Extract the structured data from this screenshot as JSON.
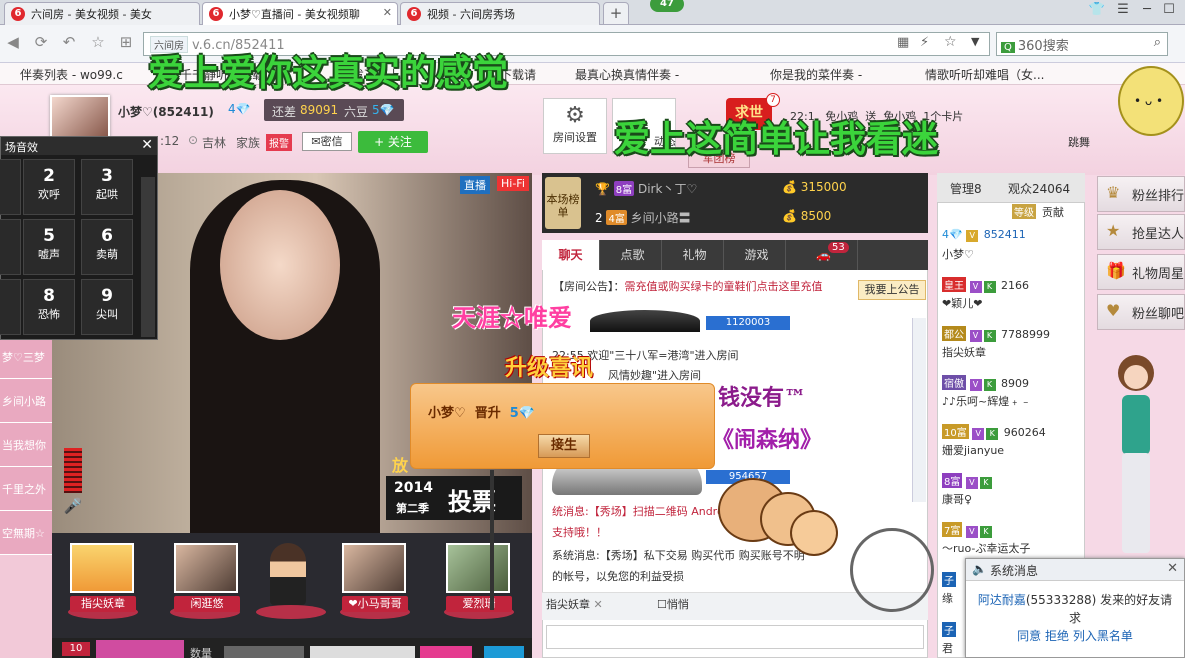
{
  "browser": {
    "tabs": [
      {
        "label": "六间房 - 美女视频 - 美女",
        "active": false
      },
      {
        "label": "小梦♡直播间 - 美女视频聊",
        "active": true
      },
      {
        "label": "视频 - 六间房秀场",
        "active": false
      }
    ],
    "notification_count": "47",
    "url_site_tag": "六间房",
    "url": "v.6.cn/852411",
    "search_placeholder": "360搜索",
    "bookmarks": [
      "伴奏列表 - wo99.c",
      "千千静听 - 下载",
      "你发不下上",
      "下载请",
      "最真心换真情伴奏 -",
      "你是我的菜伴奏 -",
      "情歌听听却难唱（女..."
    ]
  },
  "overlay_lyrics": {
    "line1": "爱上爱你这真实的感觉",
    "line2": "爱上这简单让我看迷"
  },
  "host": {
    "name": "小梦♡(852411)",
    "diamond_level": "4💎",
    "gap_label": "还差",
    "gap_value": "89091",
    "gap_unit": "六豆",
    "next_level": "5💎",
    "time": ":12",
    "location": "吉林",
    "family_label": "家族",
    "report_label": "报警",
    "message_label": "密信",
    "follow_label": "+ 关注"
  },
  "header_controls": {
    "settings_label": "房间设置",
    "dynamic_label": "动态",
    "hongbao_label": "求世",
    "hongbao_count": "7",
    "juntuan_label": "军团榜",
    "marquee": [
      "22:1",
      "免小鸡",
      "送",
      "免小鸡",
      "1个卡片",
      "跳舞"
    ]
  },
  "sound_panel": {
    "title": "场音效",
    "buttons": [
      {
        "num": "",
        "label": "声"
      },
      {
        "num": "2",
        "label": "欢呼"
      },
      {
        "num": "3",
        "label": "起哄"
      },
      {
        "num": "",
        "label": "声"
      },
      {
        "num": "5",
        "label": "嘘声"
      },
      {
        "num": "6",
        "label": "卖萌"
      },
      {
        "num": "",
        "label": "舞"
      },
      {
        "num": "8",
        "label": "恐怖"
      },
      {
        "num": "9",
        "label": "尖叫"
      }
    ]
  },
  "rank_sidebar": [
    "梦♡三梦",
    "乡间小路",
    "当我想你",
    "千里之外",
    "空無期☆"
  ],
  "video": {
    "live_tag": "直播",
    "hifi_tag": "Hi-Fi",
    "vote_year": "2014",
    "vote_season": "第二季",
    "vote_label": "投票"
  },
  "guests": [
    {
      "name": "指尖妖章"
    },
    {
      "name": "闲逛悠"
    },
    {
      "name": ""
    },
    {
      "name": "❤小马哥哥"
    },
    {
      "name": "爱烈珊"
    }
  ],
  "bottom_bar": {
    "count": "10",
    "qty_label": "数量"
  },
  "rank_panel": {
    "label": "本场榜单",
    "rows": [
      {
        "rank": "",
        "level": "8富",
        "name": "Dirk丶丁♡",
        "score": "315000"
      },
      {
        "rank": "2",
        "level": "4富",
        "name": "乡间小路〓",
        "score": "8500"
      }
    ]
  },
  "chat": {
    "tabs": [
      "聊天",
      "点歌",
      "礼物",
      "游戏",
      ""
    ],
    "vehicle_count": "53",
    "notice_prefix": "【房间公告】：",
    "notice_text": "需充值或购买绿卡的童鞋们点击这里充值",
    "notice_button": "我要上公告",
    "id_bar_1": "1120003",
    "lines": [
      "22:55 欢迎\"三十八军=港湾\"进入房间",
      "风情妙趣\"进入房间",
      "统消息:【秀场】扫描二维码 Android和iPhone",
      "支持哦！！",
      "系统消息:【秀场】私下交易 购买代币 购买账号不明",
      "的帐号，以免您的利益受损"
    ],
    "id_bar_2": "954657",
    "target_label": "指尖妖章",
    "quiet_label": "悄悄"
  },
  "overlays": {
    "tianya": "天涯☆唯爱",
    "upgrade": "升级喜讯",
    "money": "钱没有™",
    "hongsenna": "《闹森纳》",
    "promo_name": "小梦♡",
    "promo_action": "晋升",
    "promo_level": "5💎",
    "promo_button": "接生",
    "fangbanner": "放"
  },
  "user_list": {
    "tabs": {
      "admin": "管理8",
      "audience": "观众24064"
    },
    "grade_label": "等级",
    "contribution_label": "贡献",
    "host_row": {
      "level": "4💎",
      "badge": "V",
      "id": "852411",
      "nick": "小梦♡"
    },
    "rows": [
      {
        "tag": "皇王",
        "id": "2166",
        "nick": "❤颖儿❤"
      },
      {
        "tag": "都公",
        "id": "7788999",
        "nick": "指尖妖章"
      },
      {
        "tag": "宿傲",
        "id": "8909",
        "nick": "♪♪乐呵~辉煌﹢﹣"
      },
      {
        "tag": "10富",
        "id": "960264",
        "nick": "姗爱jianyue"
      },
      {
        "tag": "8富",
        "id": "",
        "nick": "康哥♀"
      },
      {
        "tag": "7富",
        "id": "",
        "nick": "〜ruo-ぷ幸运太子"
      },
      {
        "tag": "子",
        "id": "",
        "nick": "缘"
      },
      {
        "tag": "子",
        "id": "",
        "nick": "君"
      }
    ]
  },
  "side_menu": [
    "粉丝排行",
    "抢星达人",
    "礼物周星",
    "粉丝聊吧"
  ],
  "system_message": {
    "title": "系统消息",
    "requester": "阿达耐嘉",
    "requester_id": "(55333288)",
    "text": "发来的好友请求",
    "actions": [
      "同意",
      "拒绝",
      "列入黑名单"
    ]
  },
  "colors": {
    "accent_red": "#c1243c",
    "follow_green": "#3cbb3c",
    "lyric_green": "#3bd43b",
    "page_pink": "#f6d9e6"
  }
}
